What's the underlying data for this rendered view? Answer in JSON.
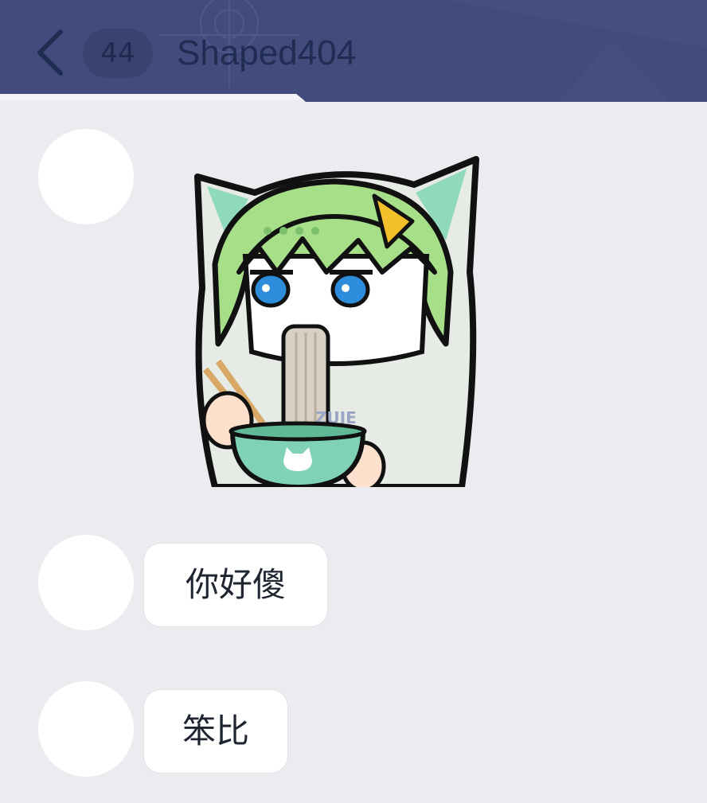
{
  "header": {
    "unread_count": "44",
    "chat_title": "Shaped404",
    "bg_color": "#434a7c"
  },
  "messages": [
    {
      "type": "sticker",
      "description_icon": "anime-girl-eating-noodles-sticker",
      "sticker_text": "ZUIE"
    },
    {
      "type": "text",
      "text": "你好傻"
    },
    {
      "type": "text",
      "text": "笨比"
    }
  ],
  "colors": {
    "chat_bg": "#ebebf0",
    "bubble_bg": "#ffffff",
    "text": "#1e2430"
  }
}
